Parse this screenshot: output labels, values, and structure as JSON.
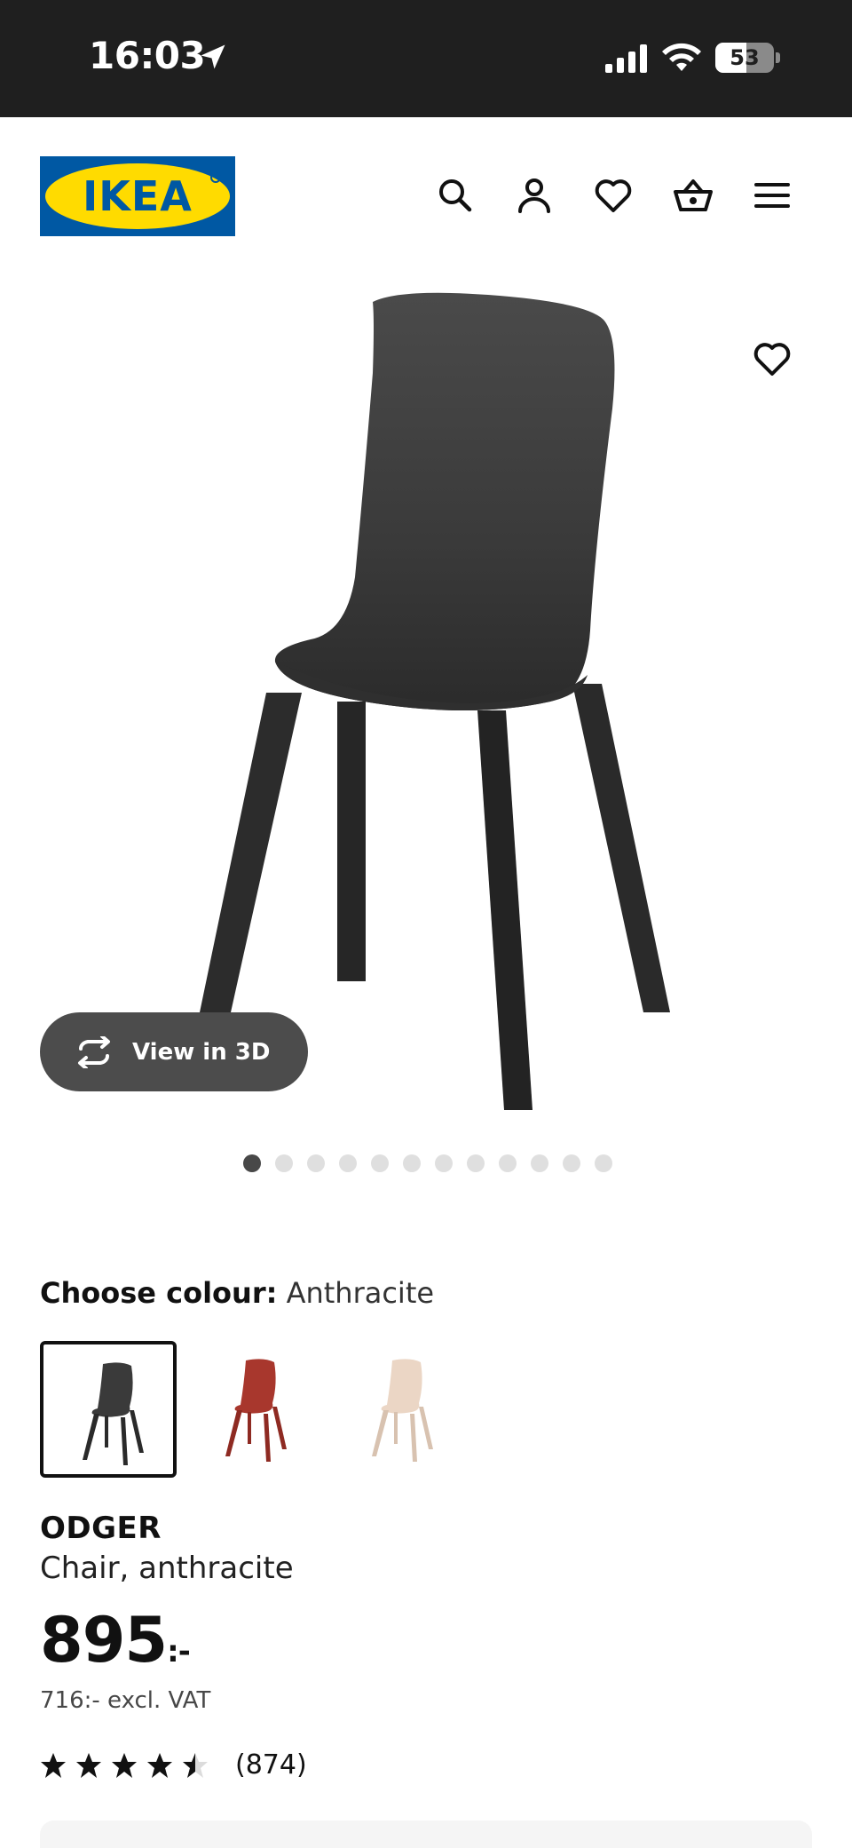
{
  "status_bar": {
    "time": "16:03",
    "battery_level": "53",
    "battery_fraction": 0.53
  },
  "header": {
    "logo_text": "IKEA",
    "icons": [
      "search-icon",
      "profile-icon",
      "wishlist-icon",
      "basket-icon",
      "menu-icon"
    ]
  },
  "gallery": {
    "view_3d_label": "View in 3D",
    "image_count": 12,
    "active_index": 0
  },
  "colour": {
    "label": "Choose colour:",
    "selected": "Anthracite",
    "swatch_colors": [
      "#3a3a3a",
      "#a8372d",
      "#e9d3c0"
    ]
  },
  "product": {
    "name": "ODGER",
    "description": "Chair, anthracite",
    "price_main": "895",
    "price_suffix": ":-",
    "price_excl_vat": "716:- excl. VAT",
    "rating": 4.5,
    "review_count": "(874)"
  }
}
